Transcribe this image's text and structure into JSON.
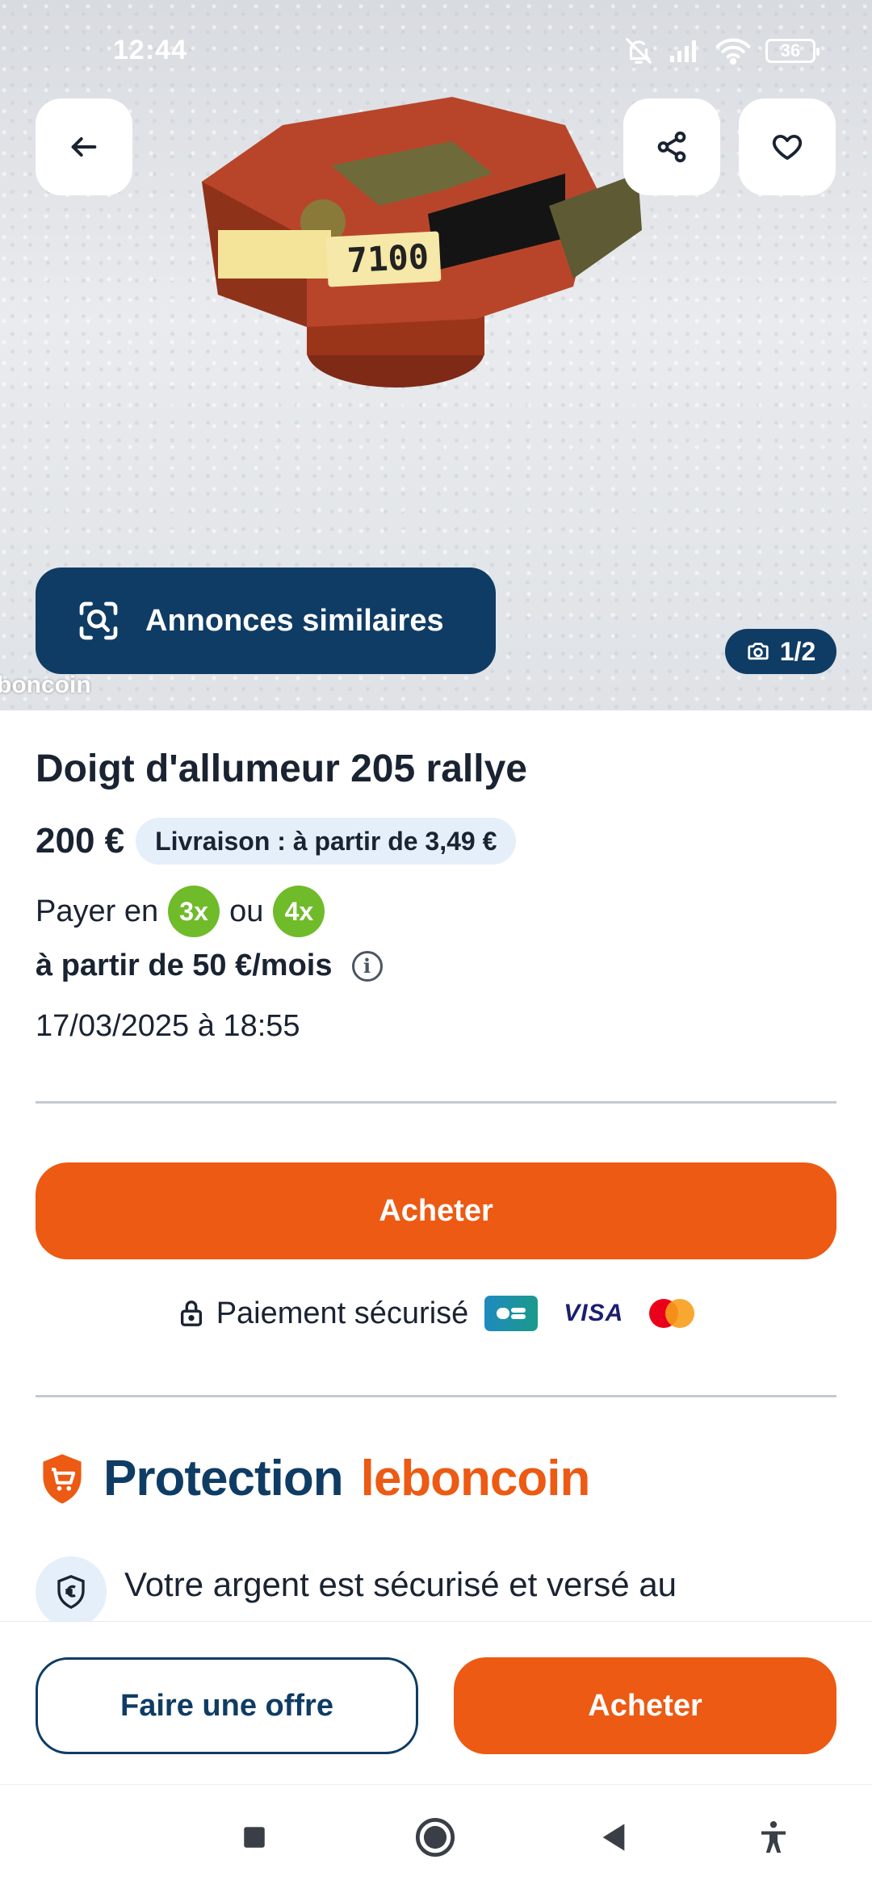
{
  "status_bar": {
    "time": "12:44",
    "battery": "36"
  },
  "gallery": {
    "similar_label": "Annonces similaires",
    "photo_counter": "1/2",
    "watermark": "boncoin",
    "label_on_item": "7100"
  },
  "listing": {
    "title": "Doigt d'allumeur 205 rallye",
    "price": "200 €",
    "delivery": "Livraison : à partir de 3,49 €",
    "pay_prefix": "Payer en",
    "pay_option_1": "3x",
    "pay_or": "ou",
    "pay_option_2": "4x",
    "monthly": "à partir de 50 €/mois",
    "date": "17/03/2025 à 18:55"
  },
  "purchase": {
    "buy_label": "Acheter",
    "secure_payment": "Paiement sécurisé",
    "card_visa": "VISA"
  },
  "protection": {
    "title_main": "Protection",
    "title_brand": "leboncoin",
    "money_secured": "Votre argent est sécurisé et versé au"
  },
  "footer": {
    "offer_label": "Faire une offre",
    "buy_label": "Acheter"
  },
  "colors": {
    "brand_orange": "#ec5a13",
    "brand_navy": "#0f3c64",
    "installment_green": "#6fbb2a",
    "delivery_badge_bg": "#e4effa"
  },
  "icons": [
    "back-arrow-icon",
    "share-icon",
    "heart-icon",
    "image-search-icon",
    "camera-icon",
    "info-icon",
    "lock-icon",
    "shield-cart-icon",
    "euro-shield-icon",
    "recents-icon",
    "home-icon",
    "nav-back-icon",
    "accessibility-icon"
  ]
}
